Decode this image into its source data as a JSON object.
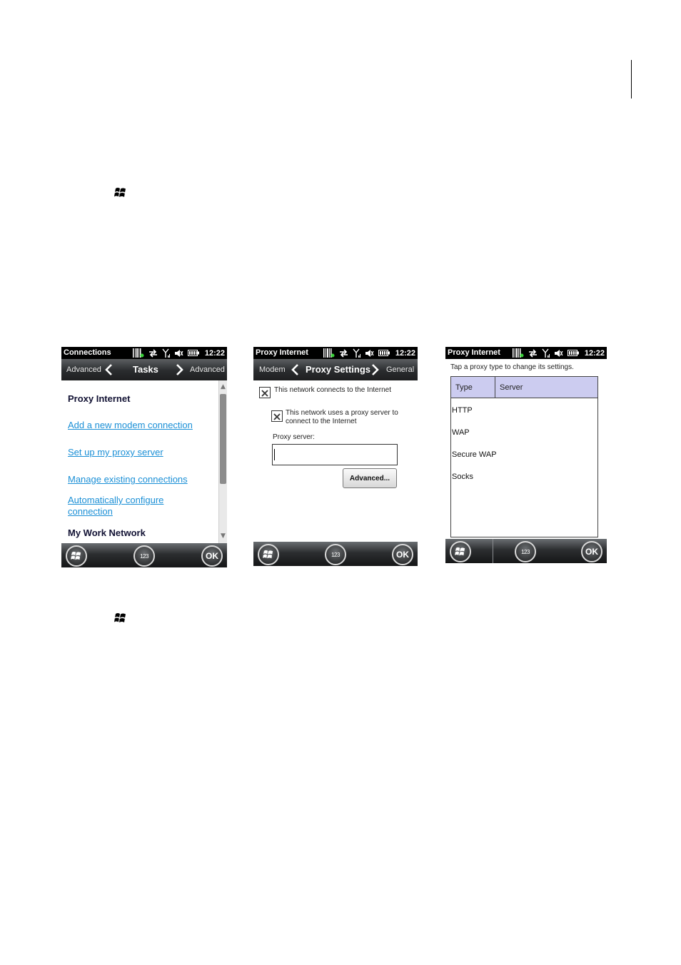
{
  "screens": [
    {
      "status_title": "Connections",
      "clock": "12:22",
      "nav_left": "Advanced",
      "nav_center": "Tasks",
      "nav_right": "Advanced",
      "items": {
        "heading1": "Proxy Internet",
        "link1": "Add a new modem connection",
        "link2": "Set up my proxy server",
        "link3": "Manage existing connections",
        "link4_line1": "Automatically configure",
        "link4_line2": "connection",
        "heading2": "My Work Network"
      },
      "softkeys": {
        "num": "123",
        "ok": "OK"
      }
    },
    {
      "status_title": "Proxy Internet",
      "clock": "12:22",
      "nav_left": "Modem",
      "nav_center": "Proxy Settings",
      "nav_right": "General",
      "checkbox1_label": "This network connects to the Internet",
      "checkbox2_line1": "This network uses a proxy server to",
      "checkbox2_line2": "connect to the Internet",
      "proxy_server_label": "Proxy server:",
      "proxy_server_value": "",
      "advanced_button": "Advanced...",
      "softkeys": {
        "num": "123",
        "ok": "OK"
      }
    },
    {
      "status_title": "Proxy Internet",
      "clock": "12:22",
      "instruction": "Tap a proxy type to change its settings.",
      "columns": [
        "Type",
        "Server"
      ],
      "rows": [
        "HTTP",
        "WAP",
        "Secure WAP",
        "Socks"
      ],
      "softkeys": {
        "num": "123",
        "ok": "OK"
      }
    }
  ]
}
